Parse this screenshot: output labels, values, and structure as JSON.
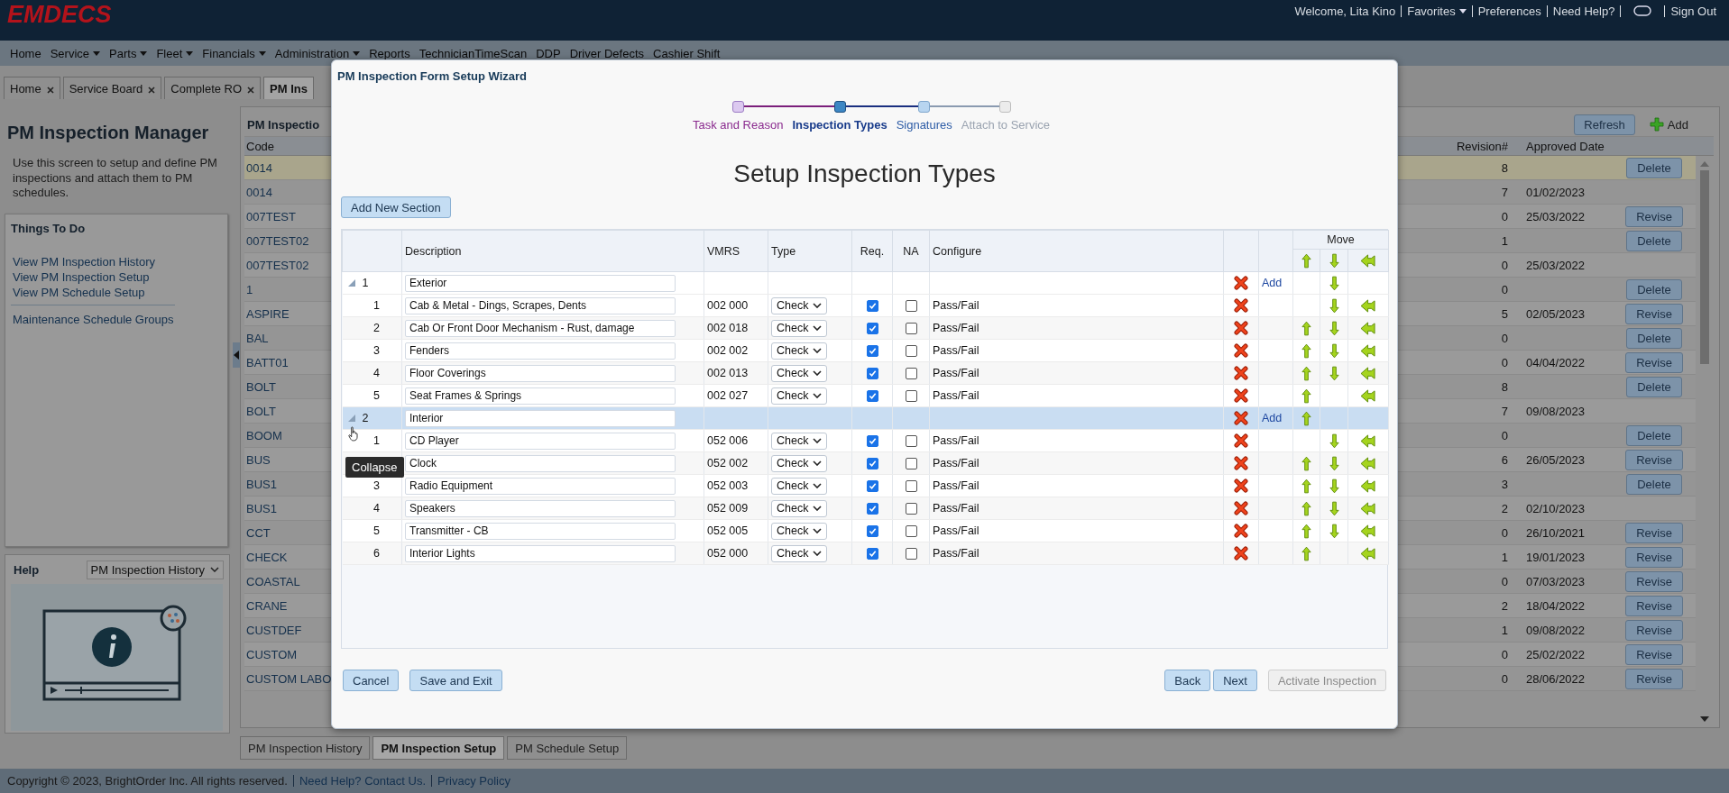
{
  "header": {
    "logo": "EMDECS",
    "links": [
      {
        "kind": "text",
        "label": "Welcome, Lita Kino"
      },
      {
        "kind": "menu",
        "label": "Favorites"
      },
      {
        "kind": "link",
        "label": "Preferences"
      },
      {
        "kind": "link",
        "label": "Need Help?"
      },
      {
        "kind": "toggle"
      },
      {
        "kind": "link",
        "label": "Sign Out"
      }
    ]
  },
  "menu": [
    {
      "label": "Home",
      "dropdown": false
    },
    {
      "label": "Service",
      "dropdown": true
    },
    {
      "label": "Parts",
      "dropdown": true
    },
    {
      "label": "Fleet",
      "dropdown": true
    },
    {
      "label": "Financials",
      "dropdown": true
    },
    {
      "label": "Administration",
      "dropdown": true
    },
    {
      "label": "Reports",
      "dropdown": false
    },
    {
      "label": "TechnicianTimeScan",
      "dropdown": false
    },
    {
      "label": "DDP",
      "dropdown": false
    },
    {
      "label": "Driver Defects",
      "dropdown": false
    },
    {
      "label": "Cashier Shift",
      "dropdown": false
    }
  ],
  "tabs": [
    {
      "label": "Home",
      "selected": false,
      "closable": true
    },
    {
      "label": "Service Board",
      "selected": false,
      "closable": true
    },
    {
      "label": "Complete RO",
      "selected": false,
      "closable": true
    },
    {
      "label": "PM Ins",
      "selected": true,
      "closable": false
    }
  ],
  "sidebar": {
    "title": "PM Inspection Manager",
    "description": "Use this screen to setup and define PM inspections and attach them to PM schedules.",
    "todo": {
      "title": "Things To Do",
      "links": [
        "View PM Inspection History",
        "View PM Inspection Setup",
        "View PM Schedule Setup"
      ],
      "extra_links": [
        "Maintenance Schedule Groups"
      ]
    },
    "help": {
      "title": "Help",
      "topic": "PM Inspection History"
    }
  },
  "grid": {
    "title": "PM Inspectio",
    "refresh": "Refresh",
    "add": "Add",
    "columns": [
      "Code",
      "Revision#",
      "Approved Date"
    ],
    "rows": [
      {
        "code": "0014",
        "revision": "8",
        "action": "Delete",
        "selected": true
      },
      {
        "code": "0014",
        "revision": "7",
        "date": "01/02/2023",
        "selected": false
      },
      {
        "code": "007TEST",
        "revision": "0",
        "date": "25/03/2022",
        "action": "Revise",
        "selected": false
      },
      {
        "code": "007TEST02",
        "revision": "1",
        "action": "Delete",
        "selected": false
      },
      {
        "code": "007TEST02",
        "revision": "0",
        "date": "25/03/2022",
        "selected": false
      },
      {
        "code": "1",
        "revision": "0",
        "action": "Delete",
        "selected": false
      },
      {
        "code": "ASPIRE",
        "revision": "5",
        "date": "02/05/2023",
        "action": "Revise",
        "selected": false
      },
      {
        "code": "BAL",
        "revision": "0",
        "action": "Delete",
        "selected": false
      },
      {
        "code": "BATT01",
        "revision": "0",
        "date": "04/04/2022",
        "action": "Revise",
        "selected": false
      },
      {
        "code": "BOLT",
        "revision": "8",
        "action": "Delete",
        "selected": false
      },
      {
        "code": "BOLT",
        "revision": "7",
        "date": "09/08/2023",
        "selected": false
      },
      {
        "code": "BOOM",
        "revision": "0",
        "action": "Delete",
        "selected": false
      },
      {
        "code": "BUS",
        "revision": "6",
        "date": "26/05/2023",
        "action": "Revise",
        "selected": false
      },
      {
        "code": "BUS1",
        "revision": "3",
        "action": "Delete",
        "selected": false
      },
      {
        "code": "BUS1",
        "revision": "2",
        "date": "02/10/2023",
        "selected": false
      },
      {
        "code": "CCT",
        "revision": "0",
        "date": "26/10/2021",
        "action": "Revise",
        "selected": false
      },
      {
        "code": "CHECK",
        "revision": "1",
        "date": "19/01/2023",
        "action": "Revise",
        "selected": false
      },
      {
        "code": "COASTAL",
        "revision": "0",
        "date": "07/03/2023",
        "action": "Revise",
        "selected": false
      },
      {
        "code": "CRANE",
        "revision": "2",
        "date": "18/04/2022",
        "action": "Revise",
        "selected": false
      },
      {
        "code": "CUSTDEF",
        "revision": "1",
        "date": "09/08/2022",
        "action": "Revise",
        "selected": false
      },
      {
        "code": "CUSTOM",
        "revision": "0",
        "date": "25/02/2022",
        "action": "Revise",
        "selected": false
      },
      {
        "code": "CUSTOM LABO",
        "revision": "0",
        "date": "28/06/2022",
        "action": "Revise",
        "selected": false
      }
    ]
  },
  "bottom_tabs": [
    {
      "label": "PM Inspection History",
      "selected": false
    },
    {
      "label": "PM Inspection Setup",
      "selected": true
    },
    {
      "label": "PM Schedule Setup",
      "selected": false
    }
  ],
  "footer": {
    "copyright": "Copyright © 2023, BrightOrder Inc. All rights reserved.",
    "links": [
      "Need Help? Contact Us.",
      "Privacy Policy"
    ]
  },
  "wizard": {
    "title": "PM Inspection Form Setup Wizard",
    "steps": [
      {
        "label": "Task and Reason",
        "kind": "done"
      },
      {
        "label": "Inspection Types",
        "kind": "current"
      },
      {
        "label": "Signatures",
        "kind": "available"
      },
      {
        "label": "Attach to Service",
        "kind": "locked"
      }
    ],
    "heading": "Setup Inspection Types",
    "add_section": "Add New Section",
    "columns": [
      "Description",
      "VMRS",
      "Type",
      "Req.",
      "NA",
      "Configure"
    ],
    "move_header": "Move",
    "sections": [
      {
        "number": "1",
        "description": "Exterior",
        "expanded": true,
        "selected": false,
        "add": "Add",
        "can_move_up": false,
        "can_move_down": true,
        "can_relocate": false,
        "items": [
          {
            "number": "1",
            "description": "Cab & Metal - Dings, Scrapes, Dents",
            "vmrs": "002 000",
            "type": "Check",
            "required": true,
            "na": false,
            "configure": "Pass/Fail",
            "can_move_up": false,
            "can_move_down": true,
            "can_relocate": true
          },
          {
            "number": "2",
            "description": "Cab Or Front Door Mechanism - Rust, damage",
            "vmrs": "002 018",
            "type": "Check",
            "required": true,
            "na": false,
            "configure": "Pass/Fail",
            "can_move_up": true,
            "can_move_down": true,
            "can_relocate": true
          },
          {
            "number": "3",
            "description": "Fenders",
            "vmrs": "002 002",
            "type": "Check",
            "required": true,
            "na": false,
            "configure": "Pass/Fail",
            "can_move_up": true,
            "can_move_down": true,
            "can_relocate": true
          },
          {
            "number": "4",
            "description": "Floor Coverings",
            "vmrs": "002 013",
            "type": "Check",
            "required": true,
            "na": false,
            "configure": "Pass/Fail",
            "can_move_up": true,
            "can_move_down": true,
            "can_relocate": true
          },
          {
            "number": "5",
            "description": "Seat Frames & Springs",
            "vmrs": "002 027",
            "type": "Check",
            "required": true,
            "na": false,
            "configure": "Pass/Fail",
            "can_move_up": true,
            "can_move_down": false,
            "can_relocate": true
          }
        ]
      },
      {
        "number": "2",
        "description": "Interior",
        "expanded": true,
        "selected": true,
        "add": "Add",
        "can_move_up": true,
        "can_move_down": false,
        "can_relocate": false,
        "items": [
          {
            "number": "1",
            "description": "CD Player",
            "vmrs": "052 006",
            "type": "Check",
            "required": true,
            "na": false,
            "configure": "Pass/Fail",
            "can_move_up": false,
            "can_move_down": true,
            "can_relocate": true
          },
          {
            "description": "Clock",
            "vmrs": "052 002",
            "type": "Check",
            "required": true,
            "na": false,
            "configure": "Pass/Fail",
            "can_move_up": true,
            "can_move_down": true,
            "can_relocate": true
          },
          {
            "number": "3",
            "description": "Radio Equipment",
            "vmrs": "052 003",
            "type": "Check",
            "required": true,
            "na": false,
            "configure": "Pass/Fail",
            "can_move_up": true,
            "can_move_down": true,
            "can_relocate": true
          },
          {
            "number": "4",
            "description": "Speakers",
            "vmrs": "052 009",
            "type": "Check",
            "required": true,
            "na": false,
            "configure": "Pass/Fail",
            "can_move_up": true,
            "can_move_down": true,
            "can_relocate": true
          },
          {
            "number": "5",
            "description": "Transmitter - CB",
            "vmrs": "052 005",
            "type": "Check",
            "required": true,
            "na": false,
            "configure": "Pass/Fail",
            "can_move_up": true,
            "can_move_down": true,
            "can_relocate": true
          },
          {
            "number": "6",
            "description": "Interior Lights",
            "vmrs": "052 000",
            "type": "Check",
            "required": true,
            "na": false,
            "configure": "Pass/Fail",
            "can_move_up": true,
            "can_move_down": false,
            "can_relocate": true
          }
        ]
      }
    ],
    "tooltip": "Collapse",
    "buttons_left": [
      {
        "label": "Cancel",
        "disabled": false
      },
      {
        "label": "Save and Exit",
        "disabled": false
      }
    ],
    "buttons_right": [
      {
        "label": "Back",
        "disabled": false
      },
      {
        "label": "Next",
        "disabled": false
      },
      {
        "label": "Activate Inspection",
        "disabled": true
      }
    ]
  }
}
